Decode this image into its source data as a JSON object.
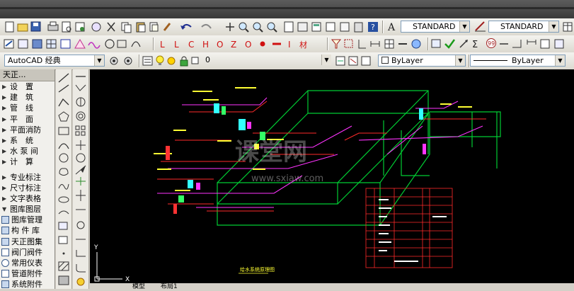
{
  "toolbar_styles": {
    "text_style": "STANDARD",
    "dim_style": "STANDARD"
  },
  "toolbar_layers": {
    "workspace": "AutoCAD 经典",
    "layer_value": "0",
    "color_value": "ByLayer",
    "linetype_value": "ByLayer"
  },
  "left_panel": {
    "header": "天正...",
    "items": [
      "设　置",
      "建　筑",
      "管　线",
      "平　面",
      "平面消防",
      "系　统",
      "水 泵 间",
      "计　算"
    ],
    "items2": [
      "专业标注",
      "尺寸标注",
      "文字表格",
      "图库图层"
    ],
    "items3": [
      "图库管理",
      "构 件 库",
      "天正图集",
      "阀门阀件",
      "常用仪表",
      "管道附件",
      "系统附件"
    ]
  },
  "canvas": {
    "watermark": "课堂网",
    "watermark_url": "www.sxiaw.com",
    "drawing_title": "给水系统原理图",
    "ucs_x": "X",
    "ucs_y": "Y",
    "tabs": [
      "模型",
      "布局1"
    ]
  },
  "colors": {
    "canvas_bg": "#000000",
    "green": "#00cc33",
    "red": "#ff2a2a",
    "magenta": "#ff33ff",
    "yellow": "#ffff33",
    "cyan": "#33ffff"
  }
}
